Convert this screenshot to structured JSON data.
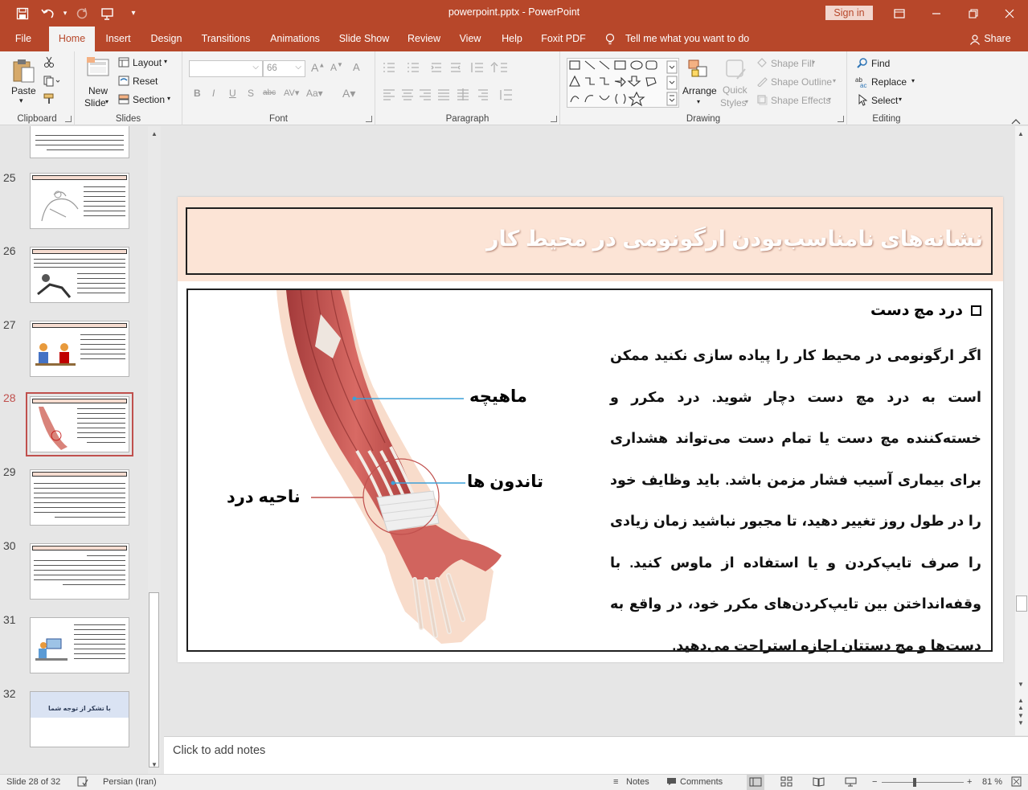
{
  "window": {
    "title": "powerpoint.pptx  -  PowerPoint",
    "sign_in": "Sign in"
  },
  "tabs": [
    "File",
    "Home",
    "Insert",
    "Design",
    "Transitions",
    "Animations",
    "Slide Show",
    "Review",
    "View",
    "Help",
    "Foxit PDF"
  ],
  "tell_me": "Tell me what you want to do",
  "share": "Share",
  "ribbon": {
    "clipboard": {
      "label": "Clipboard",
      "paste": "Paste"
    },
    "slides": {
      "label": "Slides",
      "new_slide_1": "New",
      "new_slide_2": "Slide",
      "layout": "Layout",
      "reset": "Reset",
      "section": "Section"
    },
    "font": {
      "label": "Font",
      "size": "66"
    },
    "paragraph": {
      "label": "Paragraph"
    },
    "drawing": {
      "label": "Drawing",
      "arrange": "Arrange",
      "quick_1": "Quick",
      "quick_2": "Styles",
      "shape_fill": "Shape Fill",
      "shape_outline": "Shape Outline",
      "shape_effects": "Shape Effects"
    },
    "editing": {
      "label": "Editing",
      "find": "Find",
      "replace": "Replace",
      "select": "Select"
    }
  },
  "thumbnails": [
    {
      "num": ""
    },
    {
      "num": "25"
    },
    {
      "num": "26"
    },
    {
      "num": "27"
    },
    {
      "num": "28"
    },
    {
      "num": "29"
    },
    {
      "num": "30"
    },
    {
      "num": "31"
    },
    {
      "num": "32",
      "text": "با تشکر از توجه شما"
    }
  ],
  "slide": {
    "title": "نشانه‌های نامناسب‌بودن ارگونومی در محیط کار",
    "bullet": "درد مچ دست",
    "body": "اگر ارگونومی در محیط کار را پیاده سازی نکنید ممکن است به درد مچ دست دچار شوید. درد مکرر و خسته‌کننده مچ دست یا تمام دست می‌تواند هشداری برای بیماری آسیب فشار مزمن باشد. باید وظایف خود را در طول روز تغییر دهید، تا مجبور نباشید زمان زیادی را صرف تایپ‌کردن و یا استفاده از ماوس کنید. با وقفه‌انداختن بین تایپ‌کردن‌های مکرر خود، در واقع به دست‌ها و مچ دستتان اجازه استراحت می‌دهید.",
    "label_muscle": "ماهیچه",
    "label_tendon": "تاندون ها",
    "label_pain": "ناحیه درد"
  },
  "notes_placeholder": "Click to add notes",
  "status": {
    "slide_of": "Slide 28 of 32",
    "language": "Persian (Iran)",
    "notes": "Notes",
    "comments": "Comments",
    "zoom": "81 %"
  },
  "colors": {
    "accent": "#b7472a",
    "title_band": "#fce4d6",
    "active_thumb": "#c0504d"
  }
}
